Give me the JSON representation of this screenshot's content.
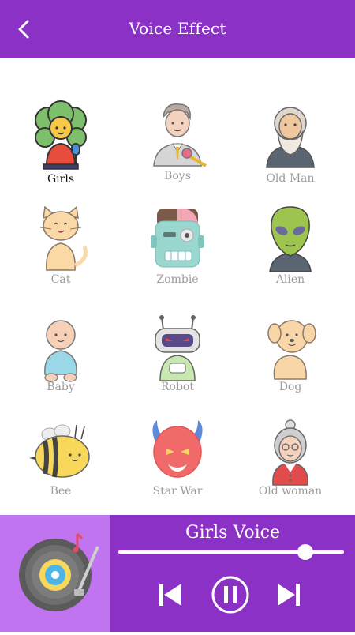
{
  "header": {
    "title": "Voice Effect"
  },
  "effects": [
    {
      "label": "Girls",
      "icon": "girl-with-microphone-icon",
      "selected": true
    },
    {
      "label": "Boys",
      "icon": "boy-with-microphone-icon"
    },
    {
      "label": "Old Man",
      "icon": "old-man-icon"
    },
    {
      "label": "Cat",
      "icon": "cat-icon"
    },
    {
      "label": "Zombie",
      "icon": "zombie-icon"
    },
    {
      "label": "Alien",
      "icon": "alien-icon"
    },
    {
      "label": "Baby",
      "icon": "baby-icon"
    },
    {
      "label": "Robot",
      "icon": "robot-icon"
    },
    {
      "label": "Dog",
      "icon": "dog-icon"
    },
    {
      "label": "Bee",
      "icon": "bee-icon"
    },
    {
      "label": "Star War",
      "icon": "devil-mask-icon"
    },
    {
      "label": "Old woman",
      "icon": "old-woman-icon"
    }
  ],
  "player": {
    "now_playing": "Girls Voice",
    "progress": 0.83,
    "colors": {
      "bar": "#8c31c6",
      "thumb_bg": "#c074f0"
    }
  }
}
